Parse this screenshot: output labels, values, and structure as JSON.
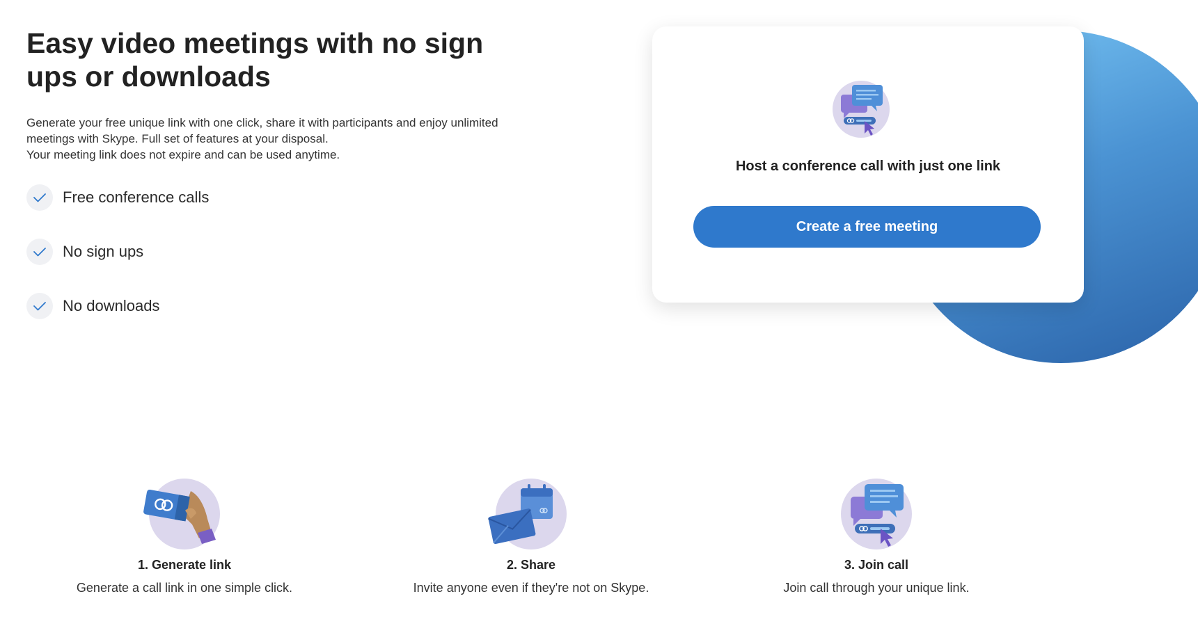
{
  "hero": {
    "title": "Easy video meetings with no sign ups or downloads",
    "description_lines": [
      "Generate your free unique link with one click, share it with participants and enjoy unlimited",
      "meetings with Skype. Full set of features at your disposal.",
      "Your meeting link does not expire and can be used anytime."
    ],
    "features": [
      {
        "label": "Free conference calls",
        "icon": "check-icon"
      },
      {
        "label": "No sign ups",
        "icon": "check-icon"
      },
      {
        "label": "No downloads",
        "icon": "check-icon"
      }
    ]
  },
  "card": {
    "icon": "chat-link-icon",
    "heading": "Host a conference call with just one link",
    "button_label": "Create a free meeting"
  },
  "steps": [
    {
      "icon": "hand-link-icon",
      "title": "1. Generate link",
      "description": "Generate a call link in one simple click."
    },
    {
      "icon": "envelope-calendar-icon",
      "title": "2. Share",
      "description": "Invite anyone even if they're not on Skype."
    },
    {
      "icon": "chat-link-icon",
      "title": "3. Join call",
      "description": "Join call through your unique link."
    }
  ],
  "colors": {
    "accent": "#2f79cc",
    "icon_bg": "#dcd7ed",
    "gradient_top": "#79c6f5",
    "gradient_bottom": "#2a62a8"
  }
}
